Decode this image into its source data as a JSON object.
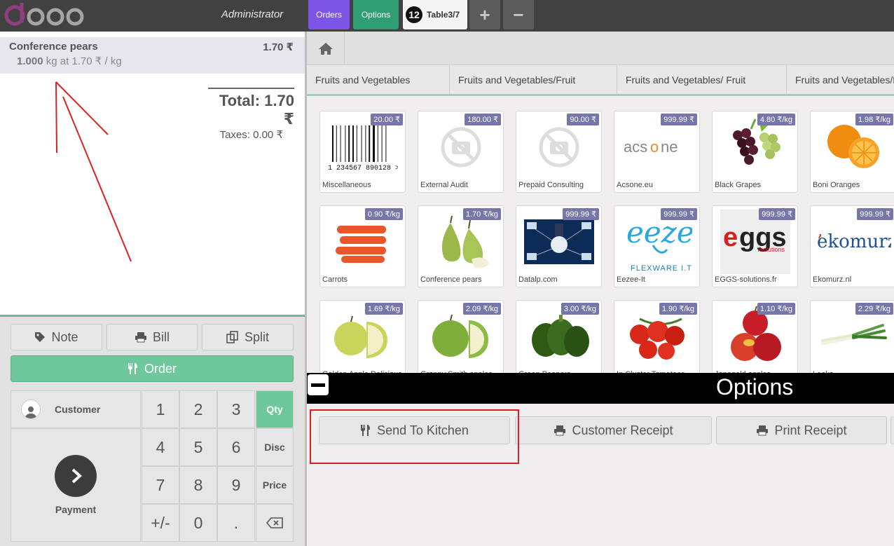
{
  "topbar": {
    "cashier": "Administrator",
    "orders_label": "Orders",
    "options_label": "Options",
    "table_guests": "12",
    "table_label": "Table3/7",
    "add_label": "+",
    "remove_label": "−"
  },
  "order": {
    "line": {
      "product": "Conference pears",
      "price": "1.70 ₹",
      "qty": "1.000",
      "unit_info": "kg at 1.70 ₹ / kg"
    },
    "total": "Total: 1.70 ₹",
    "taxes": "Taxes: 0.00 ₹"
  },
  "controls": {
    "note": "Note",
    "bill": "Bill",
    "split": "Split",
    "order": "Order",
    "customer": "Customer",
    "payment": "Payment",
    "keys": [
      "1",
      "2",
      "3",
      "4",
      "5",
      "6",
      "7",
      "8",
      "9",
      "+/-",
      "0",
      "."
    ],
    "modes": [
      "Qty",
      "Disc",
      "Price"
    ],
    "selected_mode": "Qty"
  },
  "categories": [
    "Fruits and Vegetables",
    "Fruits and Vegetables/Fruit",
    "Fruits and Vegetables/ Fruit",
    "Fruits and Vegetables/Fruit"
  ],
  "products": [
    {
      "name": "Miscellaneous",
      "price": "20.00 ₹",
      "image": "barcode"
    },
    {
      "name": "External Audit",
      "price": "180.00 ₹",
      "image": "no-image"
    },
    {
      "name": "Prepaid Consulting",
      "price": "90.00 ₹",
      "image": "no-image"
    },
    {
      "name": "Acsone.eu",
      "price": "999.99 ₹",
      "image": "acsone-logo"
    },
    {
      "name": "Black Grapes",
      "price": "4.80 ₹/kg",
      "image": "grapes"
    },
    {
      "name": "Boni Oranges",
      "price": "1.98 ₹/kg",
      "image": "oranges"
    },
    {
      "name": "Carrots",
      "price": "0.90 ₹/kg",
      "image": "carrots"
    },
    {
      "name": "Conference pears",
      "price": "1.70 ₹/kg",
      "image": "pears"
    },
    {
      "name": "Datalp.com",
      "price": "999.99 ₹",
      "image": "datalp-logo"
    },
    {
      "name": "Eezee-It",
      "price": "999.99 ₹",
      "image": "eezee-logo"
    },
    {
      "name": "EGGS-solutions.fr",
      "price": "999.99 ₹",
      "image": "eggs-logo"
    },
    {
      "name": "Ekomurz.nl",
      "price": "999.99 ₹",
      "image": "ekomurz-logo"
    },
    {
      "name": "Golden Apple Delicious",
      "price": "1.69 ₹/kg",
      "image": "golden-apple"
    },
    {
      "name": "Granny Smith apples",
      "price": "2.09 ₹/kg",
      "image": "green-apple"
    },
    {
      "name": "Green Peppers",
      "price": "3.00 ₹/kg",
      "image": "green-pepper"
    },
    {
      "name": "In Cluster Tomatoes",
      "price": "1.90 ₹/kg",
      "image": "tomatoes"
    },
    {
      "name": "Jonagold apples",
      "price": "1.10 ₹/kg",
      "image": "red-apples"
    },
    {
      "name": "Leeks",
      "price": "2.29 ₹/kg",
      "image": "leeks"
    }
  ],
  "options_panel": {
    "title": "Options",
    "send_to_kitchen": "Send To Kitchen",
    "customer_receipt": "Customer Receipt",
    "print_receipt": "Print Receipt"
  },
  "colors": {
    "orders": "#7c55e6",
    "options": "#2f9e72",
    "order_button": "#6ec89b",
    "annotation": "#e02020"
  }
}
